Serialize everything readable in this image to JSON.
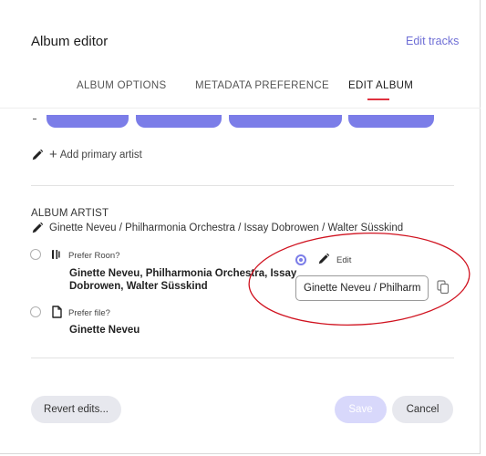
{
  "dialog": {
    "title": "Album editor",
    "edit_tracks_link": "Edit tracks"
  },
  "tabs": [
    {
      "label": "ALBUM OPTIONS",
      "active": false
    },
    {
      "label": "METADATA PREFERENCE",
      "active": false
    },
    {
      "label": "EDIT ALBUM",
      "active": true
    }
  ],
  "primary_artist": {
    "add_label": "Add primary artist",
    "icon_edit": "pencil-icon",
    "icon_add": "plus-icon"
  },
  "album_artist": {
    "section_label": "ALBUM ARTIST",
    "current_value": "Ginette Neveu / Philharmonia Orchestra / Issay Dobrowen / Walter Süsskind",
    "options": {
      "roon": {
        "label": "Prefer Roon?",
        "value_line1": "Ginette Neveu, Philharmonia Orchestra, Issay",
        "value_line2": "Dobrowen, Walter Süsskind",
        "icon": "roon-icon",
        "selected": false
      },
      "file": {
        "label": "Prefer file?",
        "value": "Ginette Neveu",
        "icon": "file-icon",
        "selected": false
      },
      "edit": {
        "label": "Edit",
        "input_value": "Ginette Neveu / Philharmonia Orchestra / Issay Dobrowen / Walter Süsskind",
        "icon": "pencil-icon",
        "copy_icon": "copy-icon",
        "selected": true
      }
    }
  },
  "footer": {
    "revert_label": "Revert edits...",
    "save_label": "Save",
    "cancel_label": "Cancel"
  },
  "colors": {
    "accent": "#7b7de8",
    "link": "#6f6fd6",
    "tab_underline": "#e0323f",
    "annotation": "#d0121f",
    "save_disabled": "#d8d8fb",
    "neutral_button": "#e7e8ee"
  }
}
